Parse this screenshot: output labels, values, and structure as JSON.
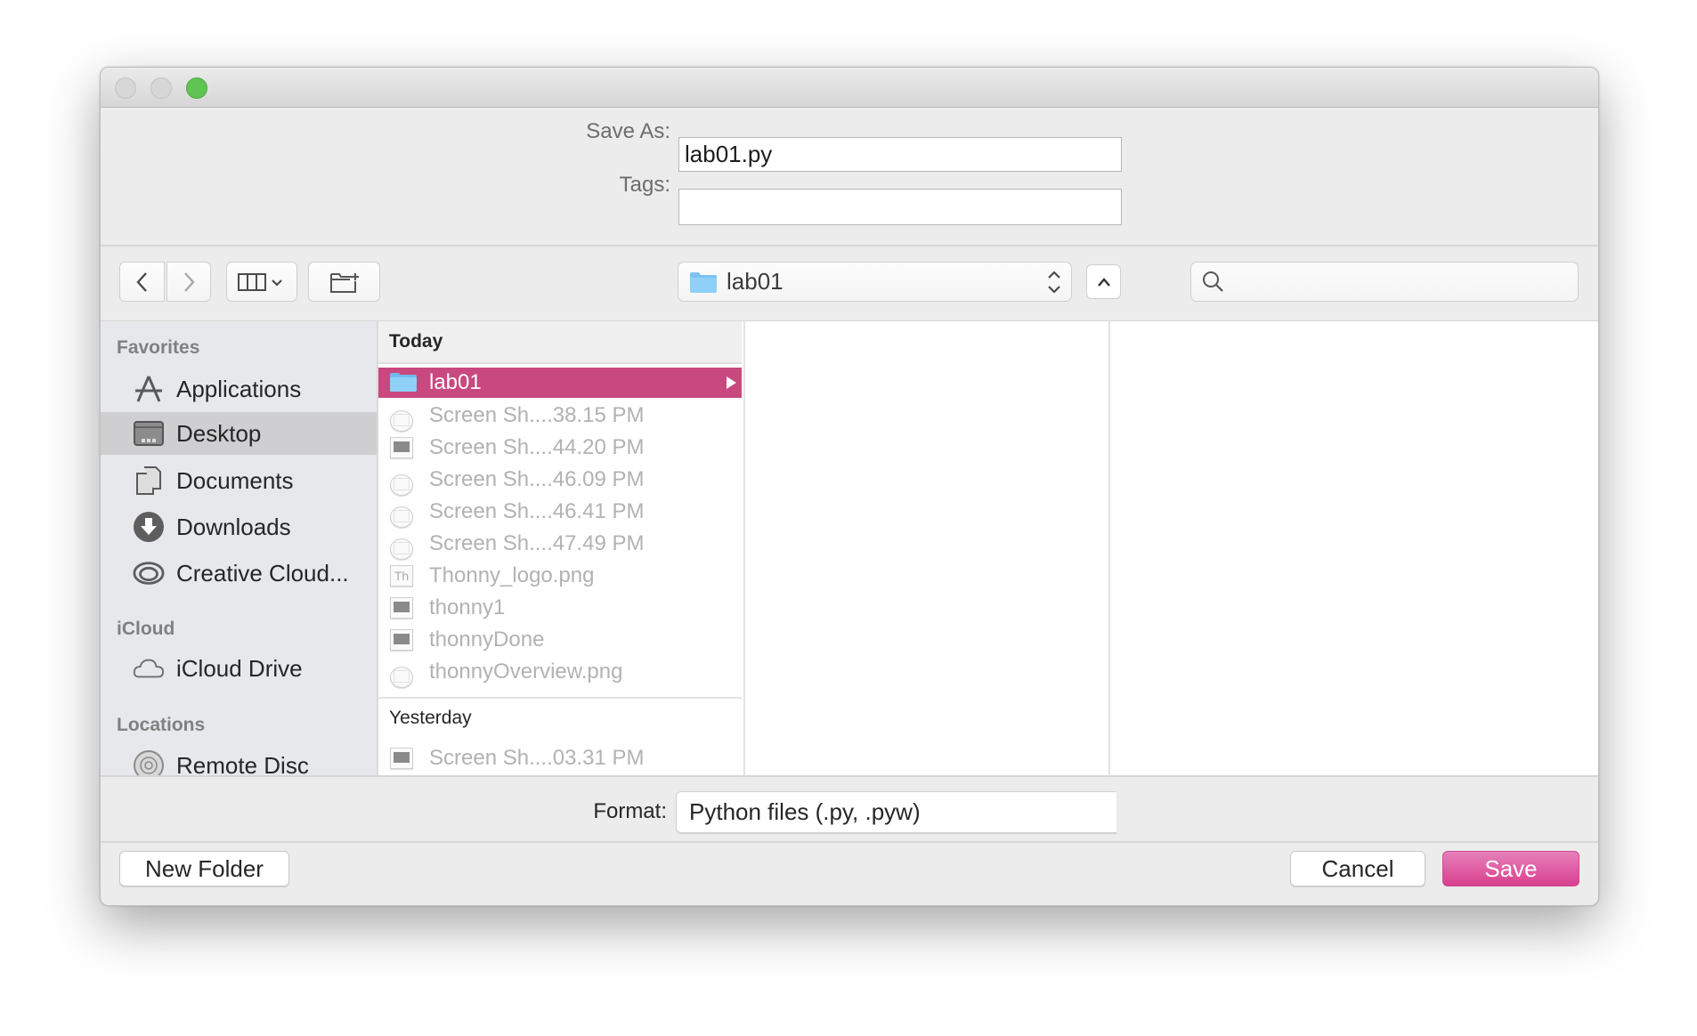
{
  "window": {
    "traffic_lights": [
      "close",
      "minimize",
      "zoom"
    ],
    "accent_color": "#c8487f",
    "primary_button_color": "#dc4b95"
  },
  "header": {
    "save_as_label": "Save As:",
    "save_as_value": "lab01.py",
    "tags_label": "Tags:",
    "tags_value": ""
  },
  "toolbar": {
    "back_icon": "chevron-left-icon",
    "forward_icon": "chevron-right-icon",
    "view_icon": "column-view-icon",
    "new_folder_icon": "folder-plus-icon",
    "location": "lab01",
    "search_placeholder": ""
  },
  "sidebar": {
    "groups": [
      {
        "label": "Favorites",
        "items": [
          {
            "label": "Applications",
            "icon": "applications-icon"
          },
          {
            "label": "Desktop",
            "icon": "desktop-icon",
            "selected": true
          },
          {
            "label": "Documents",
            "icon": "documents-icon"
          },
          {
            "label": "Downloads",
            "icon": "downloads-icon"
          },
          {
            "label": "Creative Cloud...",
            "icon": "creative-cloud-icon"
          }
        ]
      },
      {
        "label": "iCloud",
        "items": [
          {
            "label": "iCloud Drive",
            "icon": "cloud-icon"
          }
        ]
      },
      {
        "label": "Locations",
        "items": [
          {
            "label": "Remote Disc",
            "icon": "disc-icon"
          }
        ]
      }
    ]
  },
  "files": {
    "today_label": "Today",
    "yesterday_label": "Yesterday",
    "today": [
      {
        "name": "lab01",
        "type": "folder",
        "selected": true
      },
      {
        "name": "Screen Sh....38.15 PM",
        "type": "image"
      },
      {
        "name": "Screen Sh....44.20 PM",
        "type": "image"
      },
      {
        "name": "Screen Sh....46.09 PM",
        "type": "image"
      },
      {
        "name": "Screen Sh....46.41 PM",
        "type": "image"
      },
      {
        "name": "Screen Sh....47.49 PM",
        "type": "image"
      },
      {
        "name": "Thonny_logo.png",
        "type": "image"
      },
      {
        "name": "thonny1",
        "type": "image"
      },
      {
        "name": "thonnyDone",
        "type": "image"
      },
      {
        "name": "thonnyOverview.png",
        "type": "image"
      }
    ],
    "yesterday": [
      {
        "name": "Screen Sh....03.31 PM",
        "type": "image"
      }
    ]
  },
  "footer": {
    "format_label": "Format:",
    "format_value": "Python files (.py, .pyw)",
    "new_folder_label": "New Folder",
    "cancel_label": "Cancel",
    "save_label": "Save"
  }
}
